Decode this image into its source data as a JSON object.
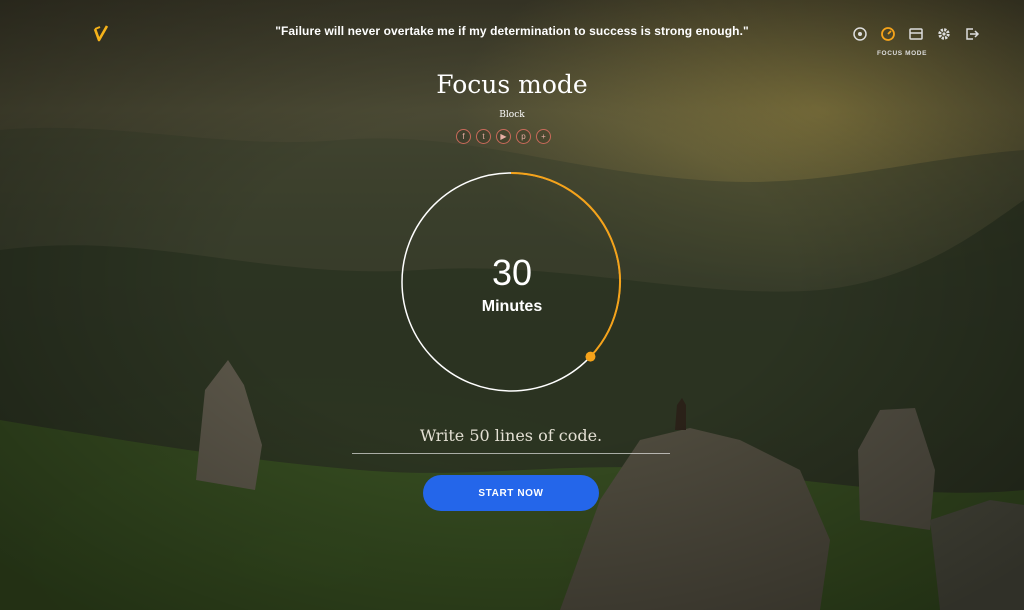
{
  "header": {
    "quote": "\"Failure will never overtake me if my determination to success is strong enough.\"",
    "icons": [
      "target-icon",
      "clock-icon",
      "window-icon",
      "gear-icon",
      "logout-icon"
    ],
    "active_caption": "FOCUS MODE"
  },
  "main": {
    "title": "Focus mode",
    "subtitle": "Block",
    "social": [
      "facebook-icon",
      "twitter-icon",
      "youtube-icon",
      "pinterest-icon",
      "add-icon"
    ],
    "timer": {
      "value": "30",
      "unit": "Minutes",
      "progress": 0.37
    },
    "goal": "Write 50 lines of code.",
    "start_label": "START NOW"
  },
  "colors": {
    "accent": "#f5a31a",
    "button": "#2466ea",
    "ring": "#ffffff"
  }
}
